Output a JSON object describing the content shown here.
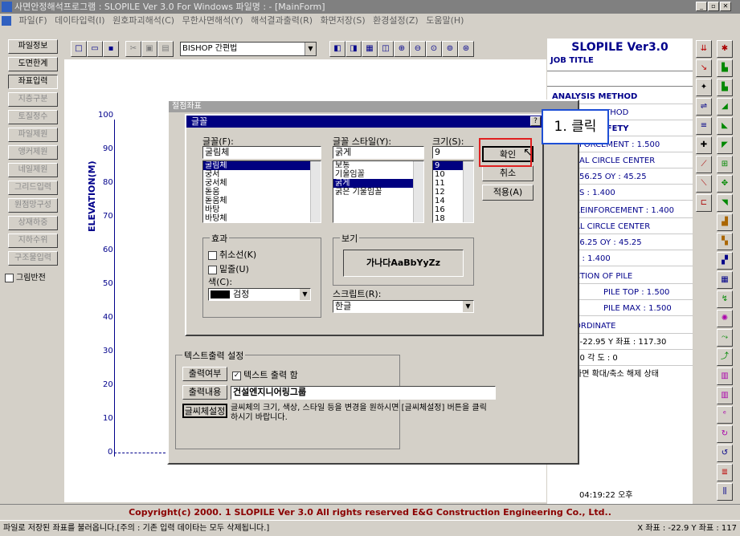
{
  "window": {
    "title": "사면안정해석프로그램 : SLOPILE Ver 3.0 For Windows 파일명 : - [MainForm]"
  },
  "menu": [
    "파일(F)",
    "데이타입력(I)",
    "원호파괴해석(C)",
    "무한사면해석(Y)",
    "해석결과출력(R)",
    "화면저장(S)",
    "환경설정(Z)",
    "도움말(H)"
  ],
  "left_buttons": [
    "파일정보",
    "도면한계",
    "좌표입력",
    "지층구분",
    "토질정수",
    "파일제원",
    "앵커제원",
    "네일제원",
    "그리드입력",
    "원점망구성",
    "상재하중",
    "지하수위",
    "구조물입력"
  ],
  "left_check": "그림반전",
  "toolbar": {
    "method_select": "BISHOP 간편법"
  },
  "plot": {
    "ylabel": "ELEVATION(M)",
    "yticks": [
      "100",
      "90",
      "80",
      "70",
      "60",
      "50",
      "40",
      "30",
      "20",
      "10",
      "0"
    ]
  },
  "right_panel": {
    "title": "SLOPILE Ver3.0",
    "job_title": "JOB TITLE",
    "rows": [
      "ANALYSIS METHOD",
      "ED METHOD",
      "OF SAFETY",
      "FORCEMENT : 1.500",
      "AL CIRCLE CENTER",
      "56.25       OY :  45.25",
      "S :                      1.400",
      "REINFORCEMENT   : 1.400",
      "AL CIRCLE CENTER",
      "56.25       OY :  45.25",
      "S :                      1.400",
      "CTION OF PILE",
      "PILE TOP :      1.500",
      "PILE MAX :      1.500",
      "ORDINATE",
      ":  -22.95  Y 좌표 :  117.30",
      ":   0            각 도 :  0",
      "화면 확대/축소 해제 상태"
    ],
    "time": "04:19:22 오후"
  },
  "dialog_outer": {
    "title": "절점좌표"
  },
  "text_output": {
    "group_title": "텍스트출력 설정",
    "btn_output": "출력여부",
    "chk_label": "텍스트 출력 함",
    "btn_content": "출력내용",
    "content_value": "건설엔지니어링그룹",
    "btn_font": "글씨체설정",
    "hint": "글씨체의 크기, 색상, 스타일 등을 변경을 원하시면 [글씨체설정] 버튼을 클릭하시기 바랍니다."
  },
  "font_dialog": {
    "title": "글꼴",
    "help": "?",
    "font_label": "글꼴(F):",
    "font_value": "굴림체",
    "fonts": [
      "굴림체",
      "궁서",
      "궁서체",
      "돋움",
      "돋움체",
      "바탕",
      "바탕체"
    ],
    "style_label": "글꼴 스타일(Y):",
    "style_value": "굵게",
    "styles": [
      "보통",
      "기울임꼴",
      "굵게",
      "굵은 기울임꼴"
    ],
    "size_label": "크기(S):",
    "size_value": "9",
    "sizes": [
      "9",
      "10",
      "11",
      "12",
      "14",
      "16",
      "18"
    ],
    "ok": "확인",
    "cancel": "취소",
    "apply": "적용(A)",
    "effects_title": "효과",
    "strike": "취소선(K)",
    "underline": "밑줄(U)",
    "color_label": "색(C):",
    "color_value": "검정",
    "preview_title": "보기",
    "preview_text": "가나다AaBbYyZz",
    "script_label": "스크립트(R):",
    "script_value": "한글"
  },
  "annotation": {
    "callout": "1. 클릭",
    "color": "#1e4fd6",
    "highlight": "#e02020"
  },
  "footer": {
    "copyright": "Copyright(c) 2000. 1 SLOPILE Ver 3.0 All rights reserved E&G Construction Engineering Co., Ltd..",
    "status_left": "파일로 저장된 좌표를 불러옵니다.[주의 : 기존 입력 데이타는 모두 삭제됩니다.]",
    "status_right": "X 좌표 :  -22.9 Y 좌표 :  117"
  }
}
